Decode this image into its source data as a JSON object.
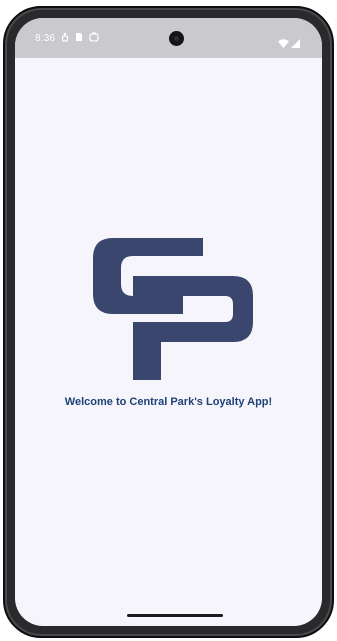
{
  "status_bar": {
    "time": "8:36",
    "icons_left": [
      "notification-icon",
      "sd-card-icon",
      "sync-icon"
    ],
    "icons_right": [
      "wifi-icon",
      "signal-icon"
    ]
  },
  "splash": {
    "logo_text": "CP",
    "welcome_text": "Welcome to Central Park's Loyalty App!"
  },
  "colors": {
    "brand": "#3a466e",
    "welcome_text": "#1f4176",
    "background": "#f6f5fb"
  }
}
